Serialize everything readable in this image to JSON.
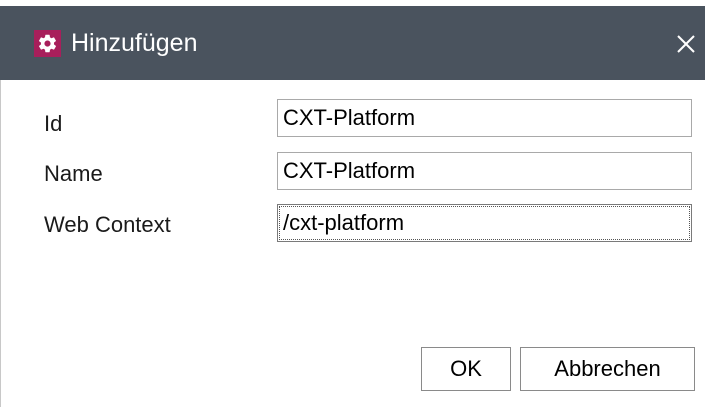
{
  "dialog": {
    "title": "Hinzufügen",
    "app_icon": "gear-icon",
    "close_icon": "close-icon",
    "colors": {
      "titlebar": "#4a535e",
      "app_icon_bg": "#a81f5b"
    }
  },
  "form": {
    "fields": [
      {
        "label": "Id",
        "value": "CXT-Platform"
      },
      {
        "label": "Name",
        "value": "CXT-Platform"
      },
      {
        "label": "Web Context",
        "value": "/cxt-platform"
      }
    ]
  },
  "buttons": {
    "ok_label": "OK",
    "cancel_label": "Abbrechen"
  }
}
